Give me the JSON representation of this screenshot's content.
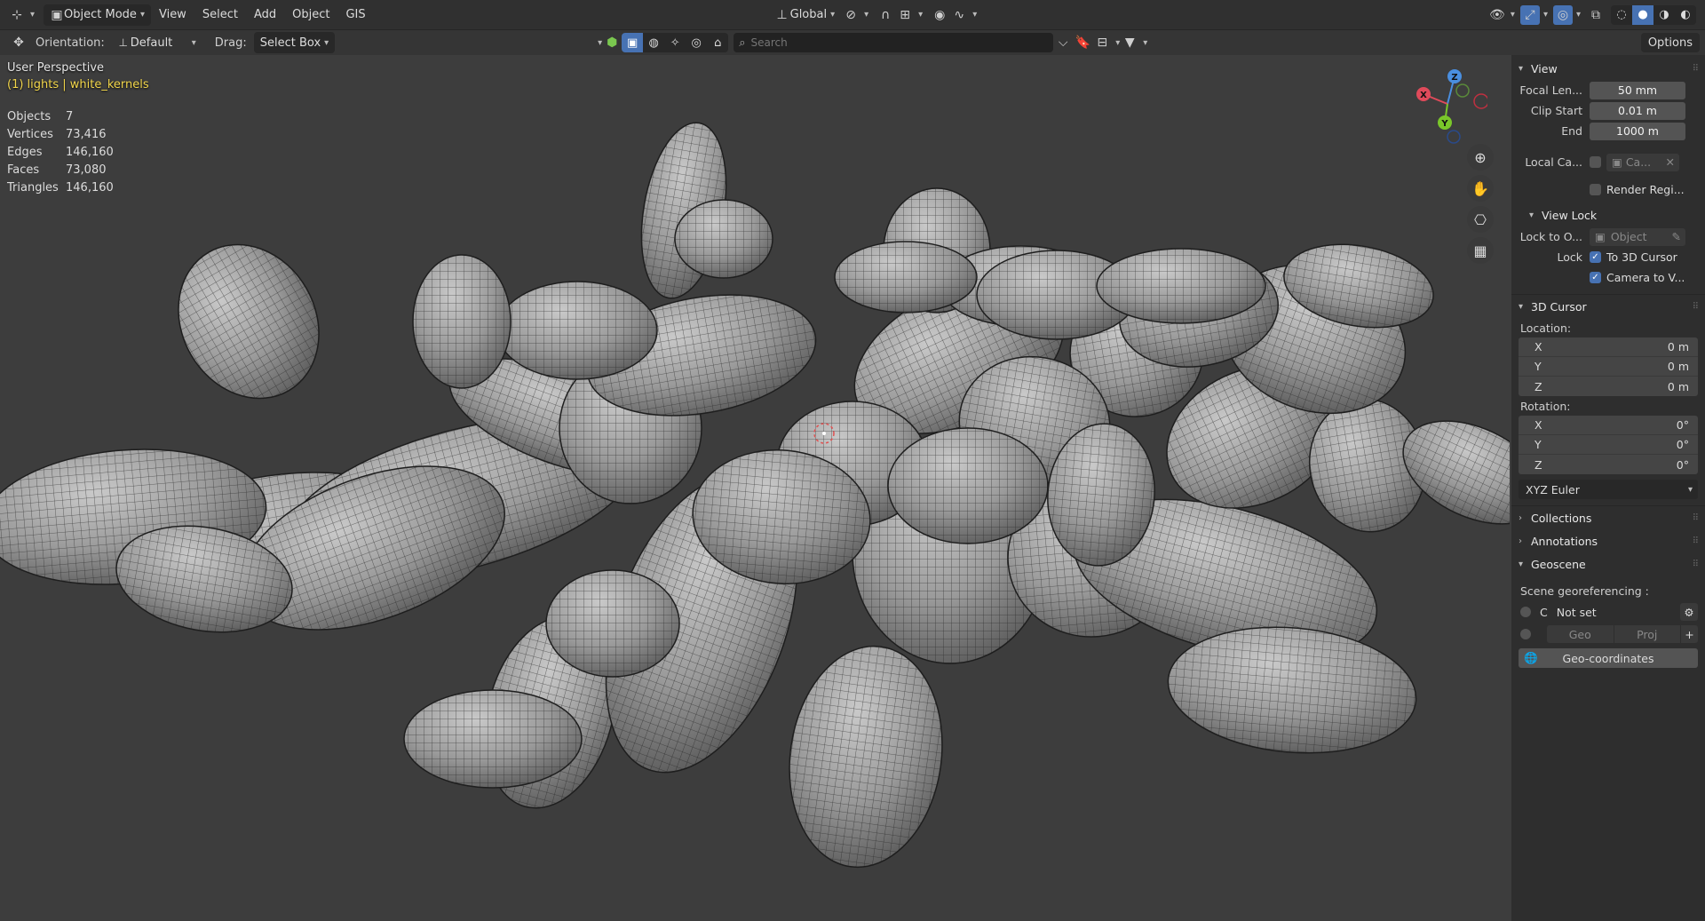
{
  "header": {
    "mode_label": "Object Mode",
    "menus": [
      "View",
      "Select",
      "Add",
      "Object",
      "GIS"
    ],
    "transform_orientation": "Global",
    "accent": "#4772b3"
  },
  "toolbar": {
    "orientation_label": "Orientation:",
    "orientation_value": "Default",
    "drag_label": "Drag:",
    "drag_value": "Select Box",
    "search_placeholder": "Search",
    "options_label": "Options"
  },
  "viewport": {
    "view_name": "User Perspective",
    "active_object": "(1) lights | white_kernels",
    "stats": [
      {
        "label": "Objects",
        "value": "7"
      },
      {
        "label": "Vertices",
        "value": "73,416"
      },
      {
        "label": "Edges",
        "value": "146,160"
      },
      {
        "label": "Faces",
        "value": "73,080"
      },
      {
        "label": "Triangles",
        "value": "146,160"
      }
    ],
    "gizmo": {
      "x": "X",
      "y": "Y",
      "z": "Z"
    }
  },
  "npanel": {
    "view": {
      "title": "View",
      "focal_length_label": "Focal Len...",
      "focal_length_value": "50 mm",
      "clip_start_label": "Clip Start",
      "clip_start_value": "0.01 m",
      "clip_end_label": "End",
      "clip_end_value": "1000 m",
      "local_camera_label": "Local Ca...",
      "local_camera_value": "Ca...",
      "render_region_label": "Render Regi..."
    },
    "view_lock": {
      "title": "View Lock",
      "lock_to_object_label": "Lock to O...",
      "lock_to_object_value": "Object",
      "lock_label": "Lock",
      "to_cursor_label": "To 3D Cursor",
      "camera_to_view_label": "Camera to V..."
    },
    "cursor": {
      "title": "3D Cursor",
      "location_label": "Location:",
      "location": [
        {
          "axis": "X",
          "value": "0 m"
        },
        {
          "axis": "Y",
          "value": "0 m"
        },
        {
          "axis": "Z",
          "value": "0 m"
        }
      ],
      "rotation_label": "Rotation:",
      "rotation": [
        {
          "axis": "X",
          "value": "0°"
        },
        {
          "axis": "Y",
          "value": "0°"
        },
        {
          "axis": "Z",
          "value": "0°"
        }
      ],
      "rotation_mode": "XYZ Euler"
    },
    "collections_title": "Collections",
    "annotations_title": "Annotations",
    "geoscene": {
      "title": "Geoscene",
      "scene_georef_label": "Scene georeferencing :",
      "crs_prefix": "C",
      "crs_value": "Not set",
      "geo_label": "Geo",
      "proj_label": "Proj",
      "geocoords_label": "Geo-coordinates"
    }
  }
}
